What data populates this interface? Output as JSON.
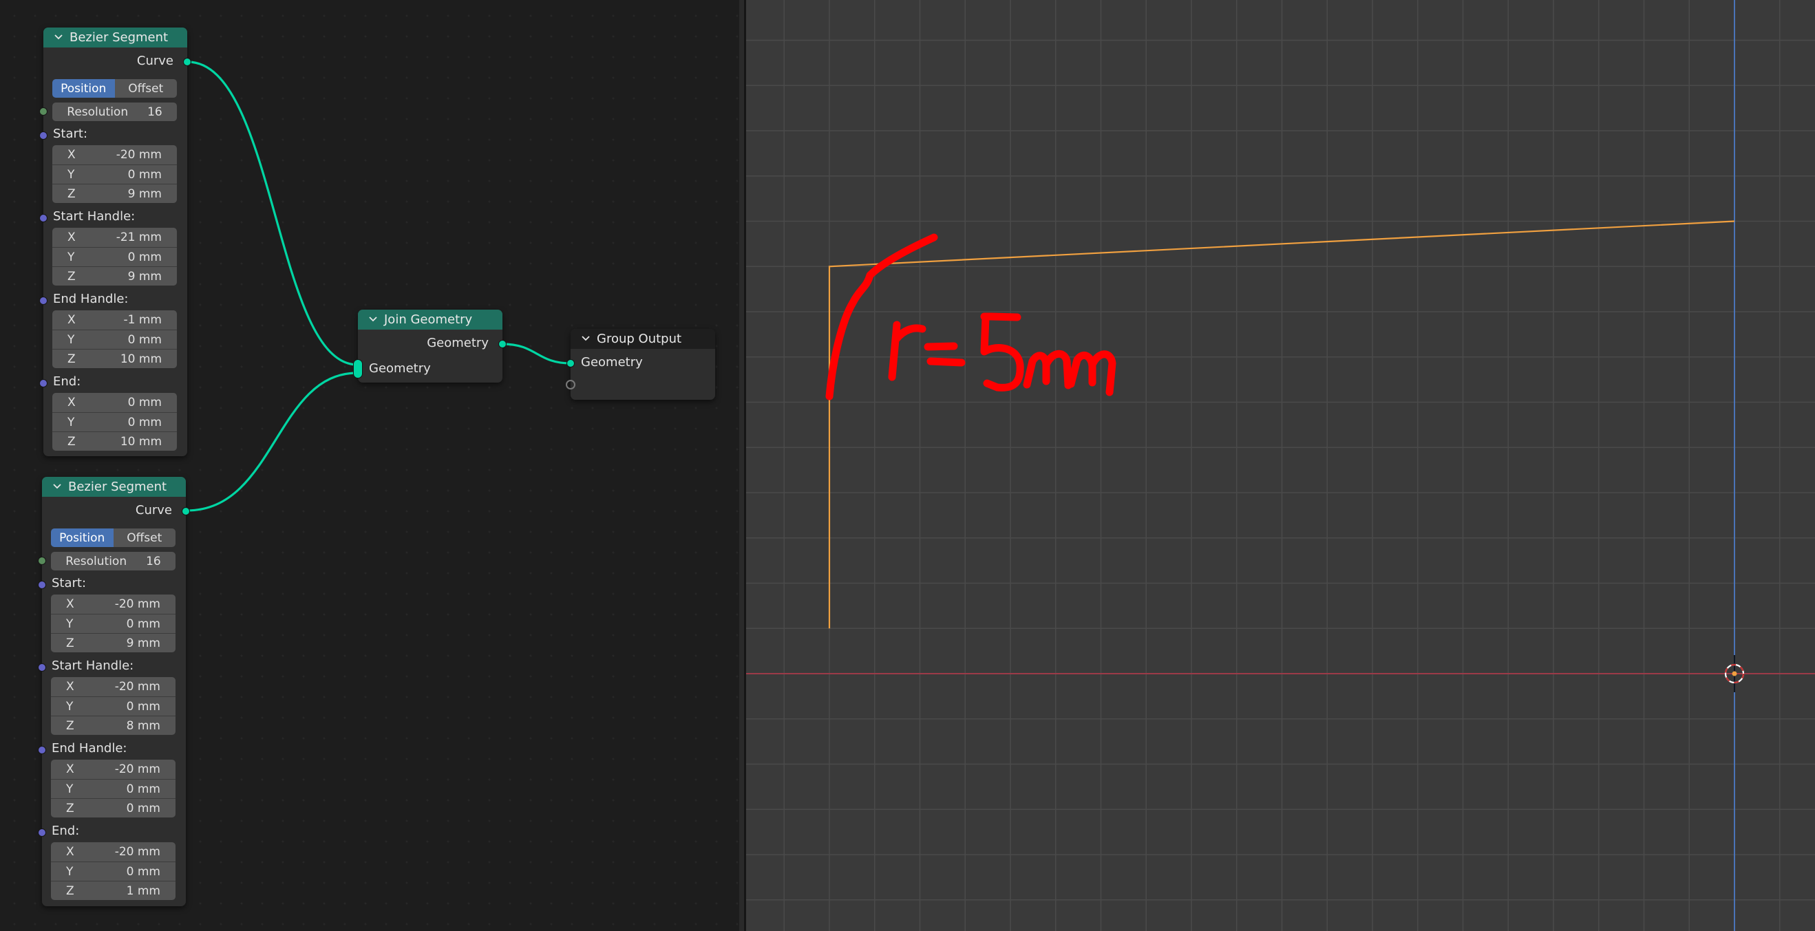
{
  "node_editor": {
    "nodes": [
      {
        "title": "Bezier Segment",
        "output": "Curve",
        "mode": {
          "options": [
            "Position",
            "Offset"
          ],
          "selected": "Position"
        },
        "resolution": {
          "label": "Resolution",
          "value": "16"
        },
        "vectors": [
          {
            "label": "Start:",
            "x": "-20 mm",
            "y": "0 mm",
            "z": "9 mm"
          },
          {
            "label": "Start Handle:",
            "x": "-21 mm",
            "y": "0 mm",
            "z": "9 mm"
          },
          {
            "label": "End Handle:",
            "x": "-1 mm",
            "y": "0 mm",
            "z": "10 mm"
          },
          {
            "label": "End:",
            "x": "0 mm",
            "y": "0 mm",
            "z": "10 mm"
          }
        ]
      },
      {
        "title": "Bezier Segment",
        "output": "Curve",
        "mode": {
          "options": [
            "Position",
            "Offset"
          ],
          "selected": "Position"
        },
        "resolution": {
          "label": "Resolution",
          "value": "16"
        },
        "vectors": [
          {
            "label": "Start:",
            "x": "-20 mm",
            "y": "0 mm",
            "z": "9 mm"
          },
          {
            "label": "Start Handle:",
            "x": "-20 mm",
            "y": "0 mm",
            "z": "8 mm"
          },
          {
            "label": "End Handle:",
            "x": "-20 mm",
            "y": "0 mm",
            "z": "0 mm"
          },
          {
            "label": "End:",
            "x": "-20 mm",
            "y": "0 mm",
            "z": "1 mm"
          }
        ]
      }
    ],
    "axis_labels": {
      "x": "X",
      "y": "Y",
      "z": "Z"
    },
    "join_geometry": {
      "title": "Join Geometry",
      "output": "Geometry",
      "input": "Geometry"
    },
    "group_output": {
      "title": "Group Output",
      "input": "Geometry"
    },
    "colors": {
      "geometry_socket": "#00d6a3",
      "vector_socket": "#6363c7",
      "int_socket": "#598c5c",
      "header_green": "#1f7060",
      "selected_mode": "#4772b3"
    }
  },
  "viewport": {
    "annotation_text": "r=5mm",
    "curve_points_mm": [
      [
        -20,
        1
      ],
      [
        -20,
        9
      ],
      [
        0,
        10
      ]
    ],
    "colors": {
      "curve": "#f0a040",
      "annotation": "#ff0000",
      "x_axis": "#9c3a48",
      "z_axis": "#4a74b8",
      "grid": "#4a4a4a"
    }
  }
}
